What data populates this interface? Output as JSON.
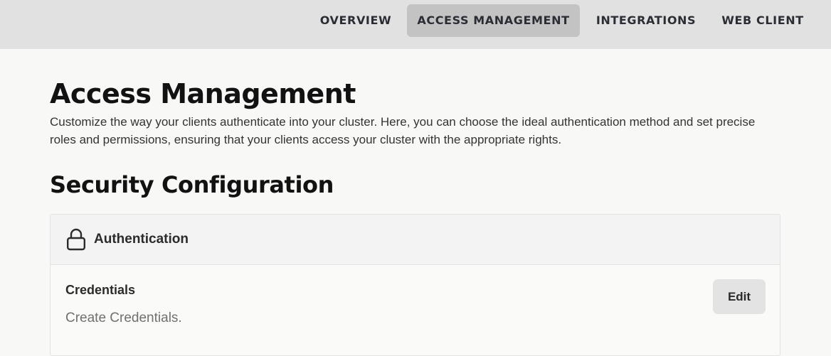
{
  "nav": {
    "tabs": [
      {
        "label": "OVERVIEW",
        "active": false
      },
      {
        "label": "ACCESS MANAGEMENT",
        "active": true
      },
      {
        "label": "INTEGRATIONS",
        "active": false
      },
      {
        "label": "WEB CLIENT",
        "active": false
      }
    ]
  },
  "page": {
    "title": "Access Management",
    "description": "Customize the way your clients authenticate into your cluster. Here, you can choose the ideal authentication method and set precise roles and permissions, ensuring that your clients access your cluster with the appropriate rights."
  },
  "security": {
    "section_title": "Security Configuration",
    "card": {
      "header_icon": "lock-icon",
      "header_label": "Authentication",
      "item_title": "Credentials",
      "item_description": "Create Credentials.",
      "edit_label": "Edit"
    }
  },
  "colors": {
    "topbar_bg": "#e1e1e1",
    "active_tab_bg": "#c3c3c3",
    "page_bg": "#f8f8f7",
    "card_header_bg": "#f3f3f3",
    "button_bg": "#e3e3e3"
  }
}
